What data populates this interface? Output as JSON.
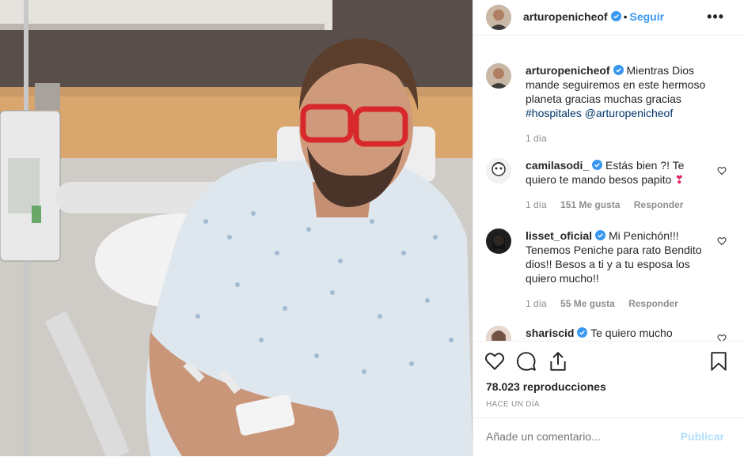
{
  "header": {
    "username": "arturopenicheof",
    "separator": "•",
    "follow_label": "Seguir",
    "more_label": "•••"
  },
  "caption": {
    "username": "arturopenicheof",
    "text": "Mientras Dios mande seguiremos en este hermoso planeta gracias muchas gracias",
    "hashtag": "#hospitales",
    "mention": "@arturopenicheof",
    "time": "1 día"
  },
  "comments": [
    {
      "username": "camilasodi_",
      "text": "Estás bien ?! Te quiero te mando besos papito",
      "emoji": "❣",
      "time": "1 día",
      "likes": "151 Me gusta",
      "reply": "Responder"
    },
    {
      "username": "lisset_oficial",
      "text": "Mi Penichón!!! Tenemos Peniche para rato Bendito dios!! Besos a ti y a tu esposa los quiero mucho!!",
      "time": "1 día",
      "likes": "55 Me gusta",
      "reply": "Responder"
    },
    {
      "username": "shariscid",
      "text": "Te quiero mucho"
    }
  ],
  "stats": {
    "views": "78.023 reproducciones",
    "time_ago": "HACE UN DÍA"
  },
  "add_comment": {
    "placeholder": "Añade un comentario...",
    "post_label": "Publicar"
  },
  "icons": {
    "like": "heart-icon",
    "comment": "comment-icon",
    "share": "share-icon",
    "save": "bookmark-icon",
    "verified": "verified-badge-icon"
  },
  "colors": {
    "accent": "#3897f0",
    "link": "#003569",
    "muted": "#8e8e8e",
    "post_disabled": "#b2dffc",
    "verified": "#3897f0",
    "emoji_heart": "#e0245e"
  }
}
